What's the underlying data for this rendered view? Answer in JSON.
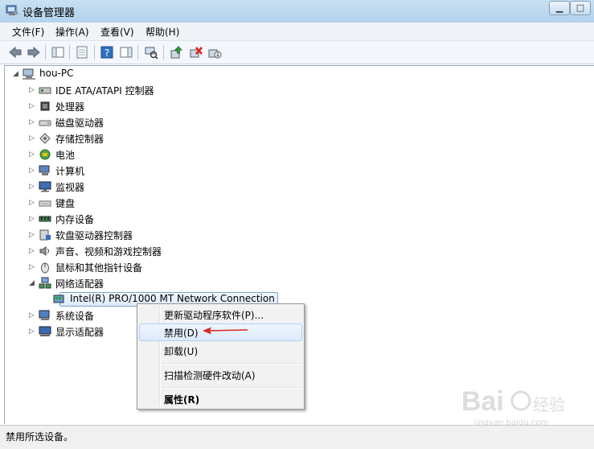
{
  "window": {
    "title": "设备管理器",
    "icon": "device-manager-icon",
    "buttons": [
      "minimize",
      "maximize"
    ]
  },
  "menu": [
    "文件(F)",
    "操作(A)",
    "查看(V)",
    "帮助(H)"
  ],
  "toolbar": [
    "back-icon",
    "forward-icon",
    "show-hide-tree-icon",
    "properties-icon",
    "help-icon",
    "action-pane-icon",
    "scan-hardware-icon",
    "update-driver-icon",
    "uninstall-icon",
    "disable-icon"
  ],
  "tree": {
    "root": "hou-PC",
    "categories": [
      {
        "label": "IDE ATA/ATAPI 控制器",
        "icon": "ide-controller-icon"
      },
      {
        "label": "处理器",
        "icon": "processor-icon"
      },
      {
        "label": "磁盘驱动器",
        "icon": "disk-drive-icon"
      },
      {
        "label": "存储控制器",
        "icon": "storage-controller-icon"
      },
      {
        "label": "电池",
        "icon": "battery-icon"
      },
      {
        "label": "计算机",
        "icon": "computer-icon"
      },
      {
        "label": "监视器",
        "icon": "monitor-icon"
      },
      {
        "label": "键盘",
        "icon": "keyboard-icon"
      },
      {
        "label": "内存设备",
        "icon": "memory-icon"
      },
      {
        "label": "软盘驱动器控制器",
        "icon": "floppy-controller-icon"
      },
      {
        "label": "声音、视频和游戏控制器",
        "icon": "sound-icon"
      },
      {
        "label": "鼠标和其他指针设备",
        "icon": "mouse-icon"
      },
      {
        "label": "网络适配器",
        "icon": "network-adapter-icon",
        "expanded": true
      },
      {
        "label": "Intel(R) PRO/1000 MT Network Connection",
        "icon": "network-card-icon",
        "child": true,
        "selected": true
      },
      {
        "label": "系统设备",
        "icon": "system-device-icon"
      },
      {
        "label": "显示适配器",
        "icon": "display-adapter-icon"
      }
    ]
  },
  "context_menu": {
    "items": [
      {
        "label": "更新驱动程序软件(P)..."
      },
      {
        "label": "禁用(D)",
        "highlighted": true
      },
      {
        "label": "卸载(U)"
      },
      {
        "label": "扫描检测硬件改动(A)"
      },
      {
        "label": "属性(R)",
        "bold": true
      }
    ]
  },
  "status": "禁用所选设备。",
  "watermark": {
    "text": "jingyan.baidu.com",
    "logo": "baidu-jingyan-logo"
  }
}
